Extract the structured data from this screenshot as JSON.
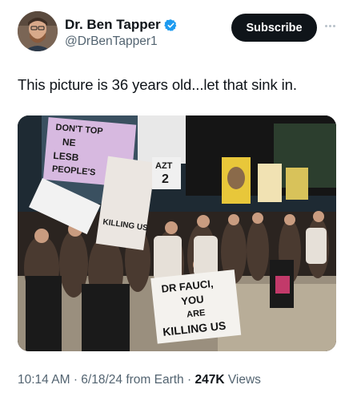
{
  "author": {
    "display_name": "Dr. Ben Tapper",
    "handle": "@DrBenTapper1",
    "verified_icon": "verified-badge-icon"
  },
  "actions": {
    "subscribe_label": "Subscribe",
    "more_icon": "more-horizontal-icon"
  },
  "tweet": {
    "text": "This picture is 36 years old...let that sink in."
  },
  "media": {
    "sign_main_line1": "DR FAUCI,",
    "sign_main_line2": "YOU",
    "sign_main_line3": "ARE",
    "sign_main_line4": "KILLING US",
    "sign_left_line1": "DON'T TOP",
    "sign_left_line2": "NE",
    "sign_left_line3": "LESB",
    "sign_left_line4": "PEOPLE'S",
    "sign_mid": "KILLING US",
    "sign_small_line1": "AZT",
    "sign_small_line2": "2"
  },
  "meta": {
    "time": "10:14 AM",
    "sep1": "·",
    "date": "6/18/24 from Earth",
    "sep2": "·",
    "views_count": "247K",
    "views_label": "Views"
  },
  "colors": {
    "text_primary": "#0f1419",
    "text_secondary": "#536471",
    "verified_blue": "#1d9bf0",
    "subscribe_bg": "#0f1419"
  }
}
